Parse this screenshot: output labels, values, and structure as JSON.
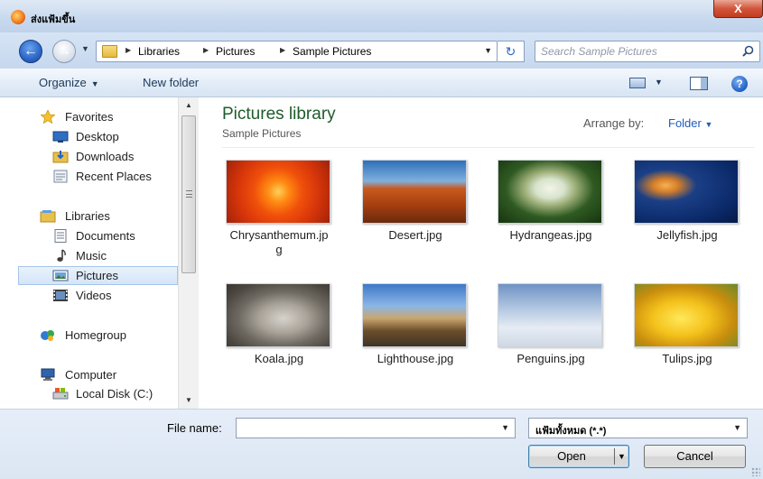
{
  "window": {
    "title": "ส่งแฟ้มขึ้น",
    "close_label": "X"
  },
  "address": {
    "breadcrumbs": [
      "Libraries",
      "Pictures",
      "Sample Pictures"
    ],
    "search_placeholder": "Search Sample Pictures"
  },
  "toolbar": {
    "organize_label": "Organize",
    "new_folder_label": "New folder"
  },
  "navigation": {
    "favorites_label": "Favorites",
    "desktop_label": "Desktop",
    "downloads_label": "Downloads",
    "recent_label": "Recent Places",
    "libraries_label": "Libraries",
    "documents_label": "Documents",
    "music_label": "Music",
    "pictures_label": "Pictures",
    "videos_label": "Videos",
    "homegroup_label": "Homegroup",
    "computer_label": "Computer",
    "local_disk_label": "Local Disk (C:)"
  },
  "content": {
    "title": "Pictures library",
    "subtitle": "Sample Pictures",
    "arrange_label": "Arrange by:",
    "arrange_value": "Folder",
    "files": [
      {
        "name": "Chrysanthemum.jpg"
      },
      {
        "name": "Desert.jpg"
      },
      {
        "name": "Hydrangeas.jpg"
      },
      {
        "name": "Jellyfish.jpg"
      },
      {
        "name": "Koala.jpg"
      },
      {
        "name": "Lighthouse.jpg"
      },
      {
        "name": "Penguins.jpg"
      },
      {
        "name": "Tulips.jpg"
      }
    ]
  },
  "footer": {
    "file_name_label": "File name:",
    "file_name_value": "",
    "file_type_value": "แฟ้มทั้งหมด (*.*)",
    "open_label": "Open",
    "cancel_label": "Cancel"
  }
}
